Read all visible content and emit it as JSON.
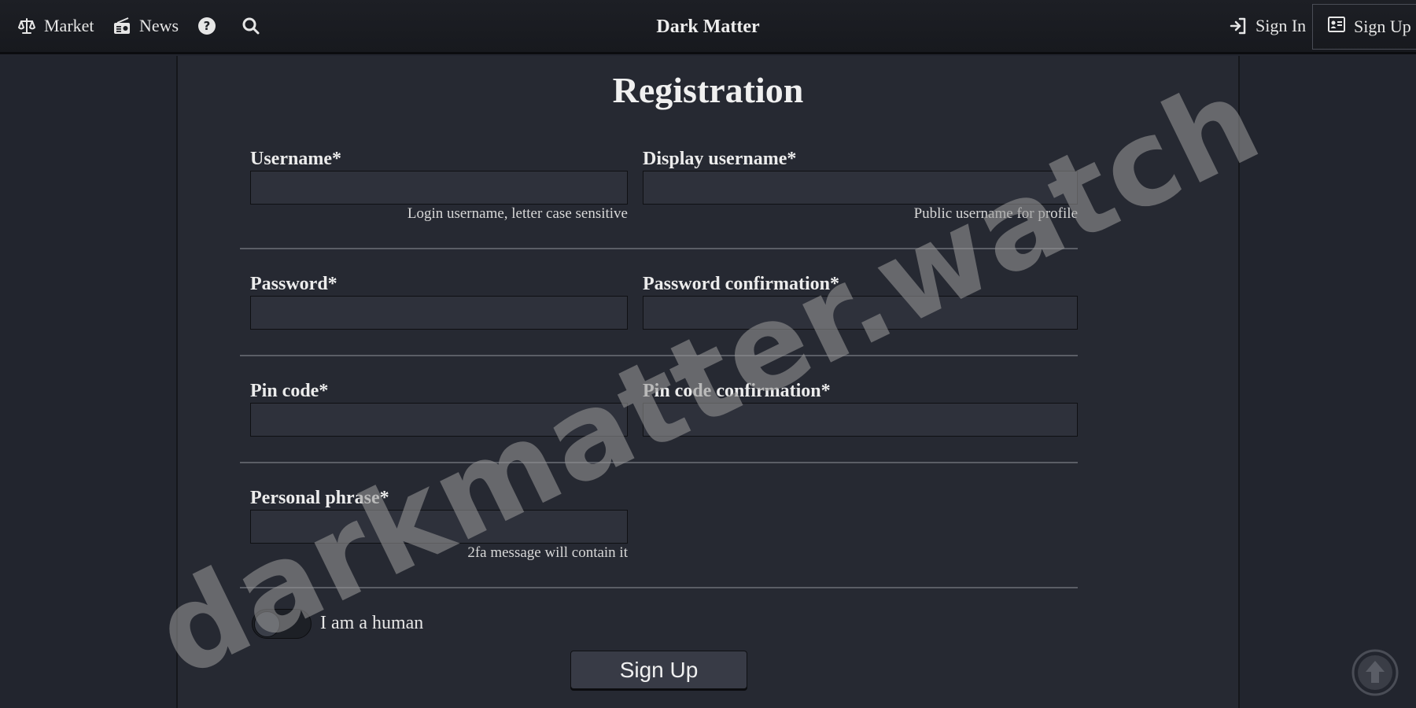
{
  "nav": {
    "market_label": "Market",
    "news_label": "News",
    "brand": "Dark Matter",
    "signin_label": "Sign In",
    "signup_label": "Sign Up",
    "icons": {
      "market": "scales-icon",
      "news": "radio-icon",
      "help": "question-circle-icon",
      "search": "search-icon",
      "signin": "sign-in-icon",
      "signup": "id-card-icon"
    }
  },
  "form": {
    "title": "Registration",
    "username": {
      "label": "Username*",
      "value": "",
      "help": "Login username, letter case sensitive"
    },
    "display_username": {
      "label": "Display username*",
      "value": "",
      "help": "Public username for profile"
    },
    "password": {
      "label": "Password*",
      "value": ""
    },
    "password_confirmation": {
      "label": "Password confirmation*",
      "value": ""
    },
    "pin_code": {
      "label": "Pin code*",
      "value": ""
    },
    "pin_code_confirmation": {
      "label": "Pin code confirmation*",
      "value": ""
    },
    "personal_phrase": {
      "label": "Personal phrase*",
      "value": "",
      "help": "2fa message will contain it"
    },
    "human_toggle": {
      "label": "I am a human",
      "checked": false
    },
    "submit_label": "Sign Up"
  },
  "watermark": "darkmatter.watch",
  "colors": {
    "background": "#22252e",
    "panel": "#262932",
    "navbar": "#1b1d22",
    "input": "#2e313b",
    "button": "#383b46"
  }
}
